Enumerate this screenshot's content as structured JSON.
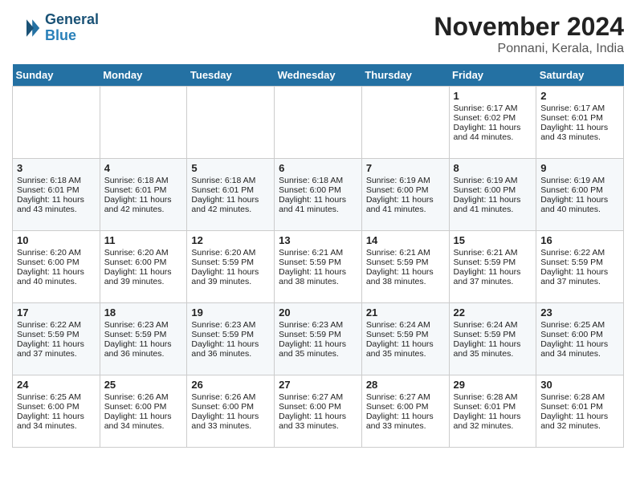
{
  "header": {
    "logo_line1": "General",
    "logo_line2": "Blue",
    "month_title": "November 2024",
    "location": "Ponnani, Kerala, India"
  },
  "days_of_week": [
    "Sunday",
    "Monday",
    "Tuesday",
    "Wednesday",
    "Thursday",
    "Friday",
    "Saturday"
  ],
  "weeks": [
    [
      {
        "day": "",
        "info": ""
      },
      {
        "day": "",
        "info": ""
      },
      {
        "day": "",
        "info": ""
      },
      {
        "day": "",
        "info": ""
      },
      {
        "day": "",
        "info": ""
      },
      {
        "day": "1",
        "info": "Sunrise: 6:17 AM\nSunset: 6:02 PM\nDaylight: 11 hours\nand 44 minutes."
      },
      {
        "day": "2",
        "info": "Sunrise: 6:17 AM\nSunset: 6:01 PM\nDaylight: 11 hours\nand 43 minutes."
      }
    ],
    [
      {
        "day": "3",
        "info": "Sunrise: 6:18 AM\nSunset: 6:01 PM\nDaylight: 11 hours\nand 43 minutes."
      },
      {
        "day": "4",
        "info": "Sunrise: 6:18 AM\nSunset: 6:01 PM\nDaylight: 11 hours\nand 42 minutes."
      },
      {
        "day": "5",
        "info": "Sunrise: 6:18 AM\nSunset: 6:01 PM\nDaylight: 11 hours\nand 42 minutes."
      },
      {
        "day": "6",
        "info": "Sunrise: 6:18 AM\nSunset: 6:00 PM\nDaylight: 11 hours\nand 41 minutes."
      },
      {
        "day": "7",
        "info": "Sunrise: 6:19 AM\nSunset: 6:00 PM\nDaylight: 11 hours\nand 41 minutes."
      },
      {
        "day": "8",
        "info": "Sunrise: 6:19 AM\nSunset: 6:00 PM\nDaylight: 11 hours\nand 41 minutes."
      },
      {
        "day": "9",
        "info": "Sunrise: 6:19 AM\nSunset: 6:00 PM\nDaylight: 11 hours\nand 40 minutes."
      }
    ],
    [
      {
        "day": "10",
        "info": "Sunrise: 6:20 AM\nSunset: 6:00 PM\nDaylight: 11 hours\nand 40 minutes."
      },
      {
        "day": "11",
        "info": "Sunrise: 6:20 AM\nSunset: 6:00 PM\nDaylight: 11 hours\nand 39 minutes."
      },
      {
        "day": "12",
        "info": "Sunrise: 6:20 AM\nSunset: 5:59 PM\nDaylight: 11 hours\nand 39 minutes."
      },
      {
        "day": "13",
        "info": "Sunrise: 6:21 AM\nSunset: 5:59 PM\nDaylight: 11 hours\nand 38 minutes."
      },
      {
        "day": "14",
        "info": "Sunrise: 6:21 AM\nSunset: 5:59 PM\nDaylight: 11 hours\nand 38 minutes."
      },
      {
        "day": "15",
        "info": "Sunrise: 6:21 AM\nSunset: 5:59 PM\nDaylight: 11 hours\nand 37 minutes."
      },
      {
        "day": "16",
        "info": "Sunrise: 6:22 AM\nSunset: 5:59 PM\nDaylight: 11 hours\nand 37 minutes."
      }
    ],
    [
      {
        "day": "17",
        "info": "Sunrise: 6:22 AM\nSunset: 5:59 PM\nDaylight: 11 hours\nand 37 minutes."
      },
      {
        "day": "18",
        "info": "Sunrise: 6:23 AM\nSunset: 5:59 PM\nDaylight: 11 hours\nand 36 minutes."
      },
      {
        "day": "19",
        "info": "Sunrise: 6:23 AM\nSunset: 5:59 PM\nDaylight: 11 hours\nand 36 minutes."
      },
      {
        "day": "20",
        "info": "Sunrise: 6:23 AM\nSunset: 5:59 PM\nDaylight: 11 hours\nand 35 minutes."
      },
      {
        "day": "21",
        "info": "Sunrise: 6:24 AM\nSunset: 5:59 PM\nDaylight: 11 hours\nand 35 minutes."
      },
      {
        "day": "22",
        "info": "Sunrise: 6:24 AM\nSunset: 5:59 PM\nDaylight: 11 hours\nand 35 minutes."
      },
      {
        "day": "23",
        "info": "Sunrise: 6:25 AM\nSunset: 6:00 PM\nDaylight: 11 hours\nand 34 minutes."
      }
    ],
    [
      {
        "day": "24",
        "info": "Sunrise: 6:25 AM\nSunset: 6:00 PM\nDaylight: 11 hours\nand 34 minutes."
      },
      {
        "day": "25",
        "info": "Sunrise: 6:26 AM\nSunset: 6:00 PM\nDaylight: 11 hours\nand 34 minutes."
      },
      {
        "day": "26",
        "info": "Sunrise: 6:26 AM\nSunset: 6:00 PM\nDaylight: 11 hours\nand 33 minutes."
      },
      {
        "day": "27",
        "info": "Sunrise: 6:27 AM\nSunset: 6:00 PM\nDaylight: 11 hours\nand 33 minutes."
      },
      {
        "day": "28",
        "info": "Sunrise: 6:27 AM\nSunset: 6:00 PM\nDaylight: 11 hours\nand 33 minutes."
      },
      {
        "day": "29",
        "info": "Sunrise: 6:28 AM\nSunset: 6:01 PM\nDaylight: 11 hours\nand 32 minutes."
      },
      {
        "day": "30",
        "info": "Sunrise: 6:28 AM\nSunset: 6:01 PM\nDaylight: 11 hours\nand 32 minutes."
      }
    ]
  ]
}
